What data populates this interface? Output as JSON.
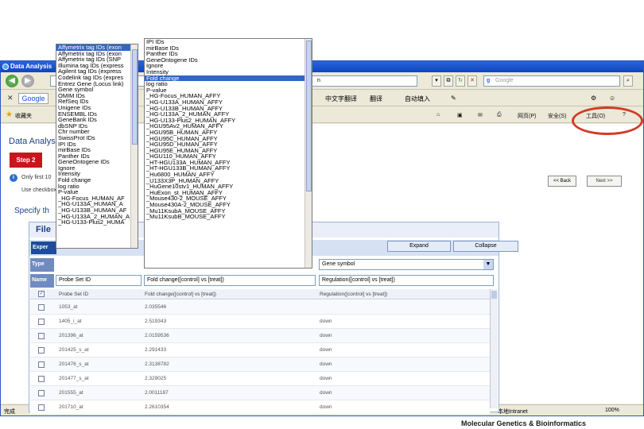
{
  "window": {
    "title": "Data Analysis"
  },
  "address_row": {
    "address_value": "n",
    "search_placeholder": "Google"
  },
  "google_bar": {
    "logo": "Google",
    "items": [
      "中文字翻译",
      "翻译",
      "自动填入",
      "✎"
    ]
  },
  "command_bar": {
    "favorites_label": "收藏夹",
    "items": [
      "网页(P)",
      "安全(S)",
      "工具(O)",
      "?"
    ]
  },
  "page": {
    "title": "Data Analysis",
    "step_label": "Step 2",
    "info_text": "Only first 10",
    "use_text": "Use checkbox",
    "specify_text": "Specify th",
    "back_label": "<< Back",
    "next_label": "Next >>"
  },
  "file_panel": {
    "title": "File",
    "exper_tab": "Exper",
    "expand_label": "Expand",
    "collapse_label": "Collapse",
    "type_label": "Type",
    "name_label": "Name",
    "type_select_3": "Gene symbol",
    "name_fields": [
      "Probe Set ID",
      "Fold change([control] vs [treat])",
      "Regulation([control] vs [treat])"
    ],
    "columns": [
      "Probe Set ID",
      "Fold change([control] vs [treat])",
      "Regulation([control] vs [treat])"
    ],
    "rows": [
      {
        "probe": "1053_at",
        "fold": "2.035546",
        "reg": ""
      },
      {
        "probe": "1405_i_at",
        "fold": "2.519343",
        "reg": "down"
      },
      {
        "probe": "201396_at",
        "fold": "2.0159536",
        "reg": "down"
      },
      {
        "probe": "201425_s_at",
        "fold": "2.291433",
        "reg": "down"
      },
      {
        "probe": "201476_s_at",
        "fold": "2.3138782",
        "reg": "down"
      },
      {
        "probe": "201477_s_at",
        "fold": "2.329025",
        "reg": "down"
      },
      {
        "probe": "201555_at",
        "fold": "2.0011187",
        "reg": "down"
      },
      {
        "probe": "201710_at",
        "fold": "2.2610354",
        "reg": "down"
      }
    ]
  },
  "dropdown_left": {
    "options": [
      "Affymetrix tag IDs (exon",
      "Affymetrix tag IDs (exon",
      "Affymetrix tag IDs (SNP",
      "Illumina tag IDs (express",
      "Agilent tag IDs (express",
      "Codelink tag IDs (expres",
      "Entrez Gene (Locus link)",
      "Gene symbol",
      "OMIM IDs",
      "RefSeq IDs",
      "Unigene IDs",
      "ENSEMBL IDs",
      "GeneBank IDs",
      "dbSNP IDs",
      "Chr number",
      "SwissProt IDs",
      "IPI IDs",
      "mirBase IDs",
      "Panther IDs",
      "GeneOntogene IDs",
      "Ignore",
      "Intensity",
      "Fold change",
      "log ratio",
      "P-value",
      "_HG-Focus_HUMAN_AF",
      "_HG-U133A_HUMAN_A",
      "_HG-U133B_HUMAN_AF",
      "_HG-U133A_2_HUMAN_A",
      "_HG-U133-Plus2_HUMA"
    ]
  },
  "dropdown_right": {
    "options": [
      "IPI IDs",
      "mirBase IDs",
      "Panther IDs",
      "GeneOntogene IDs",
      "Ignore",
      "Intensity",
      "Fold change",
      "log ratio",
      "P-value",
      "_HG-Focus_HUMAN_AFFY",
      "_HG-U133A_HUMAN_AFFY",
      "_HG-U133B_HUMAN_AFFY",
      "_HG-U133A_2_HUMAN_AFFY",
      "_HG-U133-Plus2_HUMAN_AFFY",
      "_HGU95Av2_HUMAN_AFFY",
      "_HGU95B_HUMAN_AFFY",
      "_HGU95C_HUMAN_AFFY",
      "_HGU95D_HUMAN_AFFY",
      "_HGU95E_HUMAN_AFFY",
      "_HGU110_HUMAN_AFFY",
      "_HT-HGU133A_HUMAN_AFFY",
      "_HT-HGU133B_HUMAN_AFFY",
      "_Hu6800_HUMAN_AFFY",
      "_U133X3P_HUMAN_AFFY",
      "_HuGene10stv1_HUMAN_AFFY",
      "_HuExon_st_HUMAN_AFFY",
      "_Mouse430-2_MOUSE_AFFY",
      "_Mouse430A-2_MOUSE_AFFY",
      "_Mu11KsubA_MOUSE_AFFY",
      "_Mu11KsubB_MOUSE_AFFY"
    ]
  },
  "status_bar": {
    "text": "完成",
    "zone": "本地Intranet",
    "zoom": "100%"
  },
  "footer": {
    "brand": "Molecular Genetics & Bioinformatics"
  }
}
